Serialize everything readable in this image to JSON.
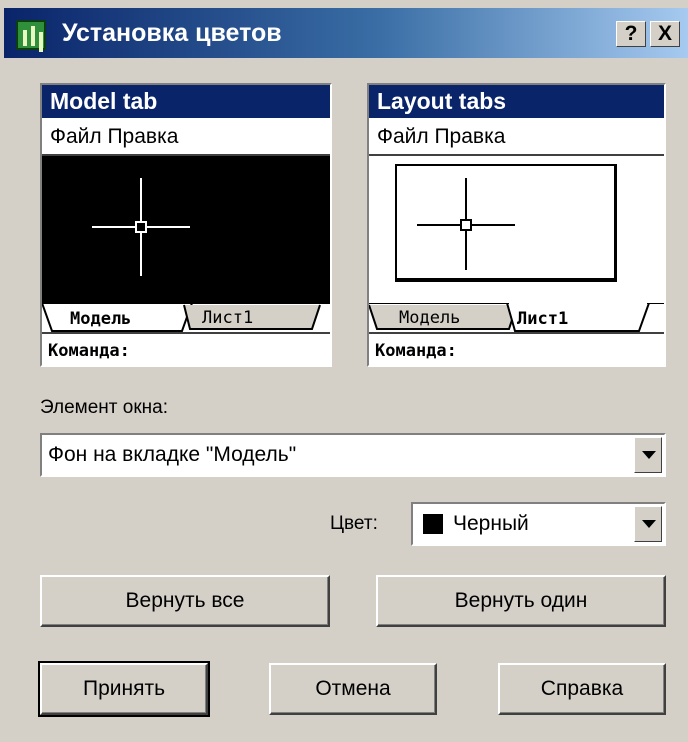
{
  "window": {
    "title": "Установка цветов",
    "help_button": "?",
    "close_button": "X"
  },
  "preview_model": {
    "header": "Model tab",
    "menu": "Файл  Правка",
    "tab_active": "Модель",
    "tab_inactive": "Лист1",
    "command_line": "Команда:"
  },
  "preview_layout": {
    "header": "Layout tabs",
    "menu": "Файл  Правка",
    "tab_inactive": "Модель",
    "tab_active": "Лист1",
    "command_line": "Команда:"
  },
  "element": {
    "label": "Элемент окна:",
    "value": "Фон на вкладке \"Модель\""
  },
  "color": {
    "label": "Цвет:",
    "value": "Черный",
    "swatch": "#000000"
  },
  "buttons": {
    "restore_all": "Вернуть все",
    "restore_one": "Вернуть один",
    "apply": "Принять",
    "cancel": "Отмена",
    "help": "Справка"
  },
  "colors": {
    "title_active": "#0a246a",
    "dialog_face": "#d4d0c8"
  }
}
